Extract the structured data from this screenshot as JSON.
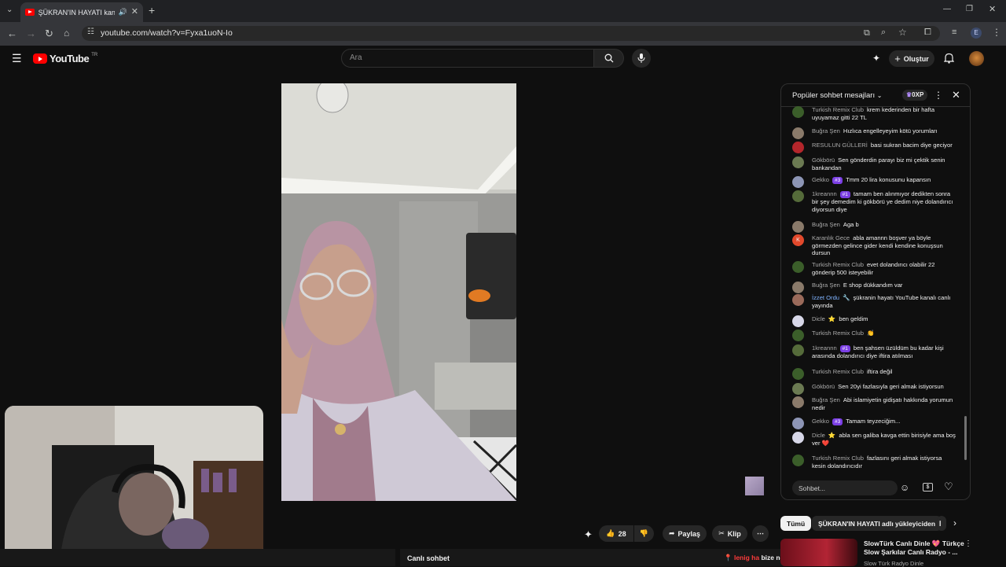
{
  "browser": {
    "tab_title": "ŞÜKRAN'IN HAYATI kanalı c",
    "new_tab": "+",
    "url": "youtube.com/watch?v=Fyxa1uoN-Io",
    "profile_letter": "E"
  },
  "youtube": {
    "logo_text": "YouTube",
    "country_code": "TR",
    "search_placeholder": "Ara",
    "create_label": "Oluştur"
  },
  "actions": {
    "like_count": "28",
    "share_label": "Paylaş",
    "clip_label": "Klip",
    "live_chat_label": "Canlı sohbet"
  },
  "chat": {
    "mode_label": "Popüler sohbet mesajları",
    "points_label": "0XP",
    "input_placeholder": "Sohbet...",
    "messages": [
      {
        "author": "Turkish Remix Club",
        "badge": "",
        "text": "krem kederinden bir hafta uyuyamaz gitti 22 TL",
        "avatar_color": "#3b5e2a"
      },
      {
        "author": "Buğra Şen",
        "badge": "",
        "text": "Hızlıca engelleyeyim kötü yorumları",
        "avatar_color": "#8a7a6a"
      },
      {
        "author": "RESULUN GÜLLERİ",
        "badge": "",
        "text": "basi sukran bacim diye geciyor",
        "avatar_color": "#b3262b"
      },
      {
        "author": "Gökbörü",
        "badge": "",
        "text": "Sen gönderdin parayı biz mi çektik senin bankandan",
        "avatar_color": "#6b7a52"
      },
      {
        "author": "Gekko",
        "badge": "#3",
        "text": "Tmm 20 lira konusunu kapansın",
        "avatar_color": "#8d95b5"
      },
      {
        "author": "1kreannn",
        "badge": "#1",
        "text": "tamam ben alınmıyor dedikten sonra bir şey demedim ki gökbörü ye dedim niye dolandırıcı diyorsun diye",
        "avatar_color": "#556b3a"
      },
      {
        "author": "Buğra Şen",
        "badge": "",
        "text": "Aga b",
        "avatar_color": "#8a7a6a"
      },
      {
        "author": "Karanlık Gece",
        "badge": "",
        "text": "abla amannn boşver ya böyle görmezden gelince gider kendi kendine konuşsun dursun",
        "avatar_color": "#e2492c",
        "avatar_letter": "K"
      },
      {
        "author": "Turkish Remix Club",
        "badge": "",
        "text": "evet dolandırıcı olabilir 22 gönderip 500 isteyebilir",
        "avatar_color": "#3b5e2a"
      },
      {
        "author": "Buğra Şen",
        "badge": "",
        "text": "E shop dükkandım var",
        "avatar_color": "#8a7a6a"
      },
      {
        "author": "İzzet Ordu",
        "badge": "",
        "text": "şükranin hayatı YouTube kanalı canlı yayında",
        "avatar_color": "#9a6a5a",
        "blue": true,
        "wrench": "🔧"
      },
      {
        "author": "Dicle",
        "badge": "",
        "text": "ben geldim",
        "avatar_color": "#d7d7e8",
        "star": "⭐"
      },
      {
        "author": "Turkish Remix Club",
        "badge": "",
        "text": "👏",
        "avatar_color": "#3b5e2a"
      },
      {
        "author": "1kreannn",
        "badge": "#1",
        "text": "ben şahsen üzüldüm bu kadar kişi arasında dolandırıcı diye iftira atılması",
        "avatar_color": "#556b3a"
      },
      {
        "author": "Turkish Remix Club",
        "badge": "",
        "text": "iftira değil",
        "avatar_color": "#3b5e2a"
      },
      {
        "author": "Gökbörü",
        "badge": "",
        "text": "Sen 20yi fazlasıyla geri almak istiyorsun",
        "avatar_color": "#6b7a52"
      },
      {
        "author": "Buğra Şen",
        "badge": "",
        "text": "Abi islamiyetin gidişatı hakkında yorumun nedir",
        "avatar_color": "#8a7a6a"
      },
      {
        "author": "Gekko",
        "badge": "#3",
        "text": "Tamam teyzeciğim...",
        "avatar_color": "#8d95b5"
      },
      {
        "author": "Dicle",
        "badge": "",
        "text": "abla sen galiba kavga ettin birisiyle ama boş ver ❤️",
        "avatar_color": "#d7d7e8",
        "star": "⭐"
      },
      {
        "author": "Turkish Remix Club",
        "badge": "",
        "text": "fazlasını geri almak istiyorsa kesin dolandırıcıdır",
        "avatar_color": "#3b5e2a"
      }
    ]
  },
  "chips": [
    "Tümü",
    "ŞÜKRAN'IN HAYATI adlı yükleyiciden",
    "İ"
  ],
  "recommendation": {
    "title": "SlowTürk Canlı Dinle 💖 Türkçe Slow Şarkılar Canlı Radyo - ...",
    "channel": "Slow Türk Radyo Dinle"
  },
  "overlay": {
    "donor": "lenig ha",
    "text": "bize ne sukrandan ya"
  }
}
